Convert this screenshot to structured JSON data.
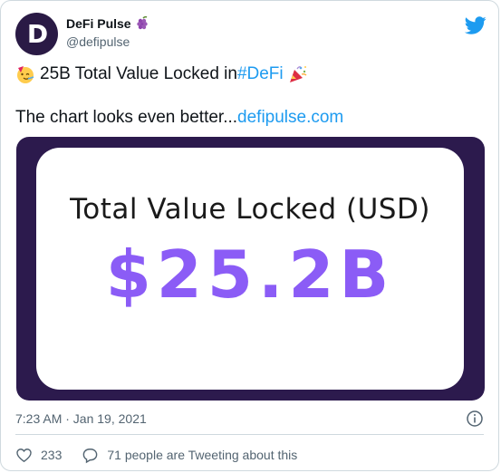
{
  "user": {
    "display_name": "DeFi Pulse",
    "handle": "@defipulse",
    "avatar_letter": "D"
  },
  "tweet": {
    "line1_text": "25B Total Value Locked in ",
    "line1_hashtag": "#DeFi",
    "line2_text": "The chart looks even better... ",
    "line2_link": "defipulse.com"
  },
  "media": {
    "title": "Total Value Locked (USD)",
    "value": "$25.2B",
    "frame_color": "#2c1a4d",
    "value_color": "#8b5cf6"
  },
  "meta": {
    "timestamp": "7:23 AM · Jan 19, 2021"
  },
  "actions": {
    "likes": "233",
    "tweeting_text": "71 people are Tweeting about this"
  },
  "colors": {
    "accent": "#1d9bf0",
    "secondary_text": "#536471",
    "border": "#cfd9de"
  }
}
